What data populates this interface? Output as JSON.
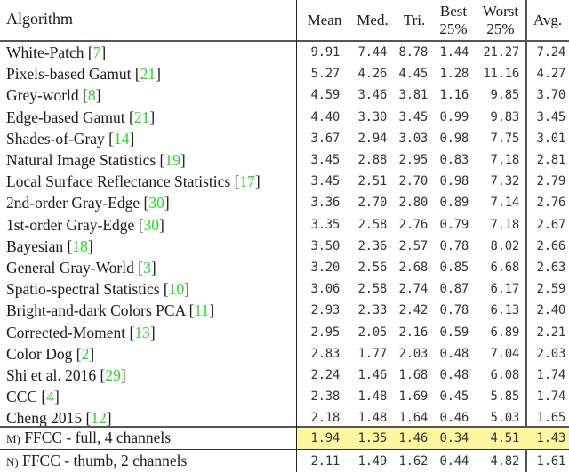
{
  "table": {
    "header": {
      "algorithm": "Algorithm",
      "columns": [
        {
          "l1": "Mean",
          "l2": ""
        },
        {
          "l1": "Med.",
          "l2": ""
        },
        {
          "l1": "Tri.",
          "l2": ""
        },
        {
          "l1": "Best",
          "l2": "25%"
        },
        {
          "l1": "Worst",
          "l2": "25%"
        },
        {
          "l1": "Avg.",
          "l2": ""
        }
      ]
    },
    "rows": [
      {
        "name": "White-Patch ",
        "ref": "7",
        "values": [
          "9.91",
          "7.44",
          "8.78",
          "1.44",
          "21.27",
          "7.24"
        ]
      },
      {
        "name": "Pixels-based Gamut ",
        "ref": "21",
        "values": [
          "5.27",
          "4.26",
          "4.45",
          "1.28",
          "11.16",
          "4.27"
        ]
      },
      {
        "name": "Grey-world ",
        "ref": "8",
        "values": [
          "4.59",
          "3.46",
          "3.81",
          "1.16",
          "9.85",
          "3.70"
        ]
      },
      {
        "name": "Edge-based Gamut ",
        "ref": "21",
        "values": [
          "4.40",
          "3.30",
          "3.45",
          "0.99",
          "9.83",
          "3.45"
        ]
      },
      {
        "name": "Shades-of-Gray ",
        "ref": "14",
        "values": [
          "3.67",
          "2.94",
          "3.03",
          "0.98",
          "7.75",
          "3.01"
        ]
      },
      {
        "name": "Natural Image Statistics ",
        "ref": "19",
        "values": [
          "3.45",
          "2.88",
          "2.95",
          "0.83",
          "7.18",
          "2.81"
        ]
      },
      {
        "name": "Local Surface Reflectance Statistics ",
        "ref": "17",
        "values": [
          "3.45",
          "2.51",
          "2.70",
          "0.98",
          "7.32",
          "2.79"
        ]
      },
      {
        "name": "2nd-order Gray-Edge ",
        "ref": "30",
        "values": [
          "3.36",
          "2.70",
          "2.80",
          "0.89",
          "7.14",
          "2.76"
        ]
      },
      {
        "name": "1st-order Gray-Edge ",
        "ref": "30",
        "values": [
          "3.35",
          "2.58",
          "2.76",
          "0.79",
          "7.18",
          "2.67"
        ]
      },
      {
        "name": "Bayesian ",
        "ref": "18",
        "values": [
          "3.50",
          "2.36",
          "2.57",
          "0.78",
          "8.02",
          "2.66"
        ]
      },
      {
        "name": "General Gray-World ",
        "ref": "3",
        "values": [
          "3.20",
          "2.56",
          "2.68",
          "0.85",
          "6.68",
          "2.63"
        ]
      },
      {
        "name": "Spatio-spectral Statistics ",
        "ref": "10",
        "values": [
          "3.06",
          "2.58",
          "2.74",
          "0.87",
          "6.17",
          "2.59"
        ]
      },
      {
        "name": "Bright-and-dark Colors PCA ",
        "ref": "11",
        "values": [
          "2.93",
          "2.33",
          "2.42",
          "0.78",
          "6.13",
          "2.40"
        ]
      },
      {
        "name": "Corrected-Moment ",
        "ref": "13",
        "values": [
          "2.95",
          "2.05",
          "2.16",
          "0.59",
          "6.89",
          "2.21"
        ]
      },
      {
        "name": "Color Dog ",
        "ref": "2",
        "values": [
          "2.83",
          "1.77",
          "2.03",
          "0.48",
          "7.04",
          "2.03"
        ]
      },
      {
        "name": "Shi et al. 2016 ",
        "ref": "29",
        "values": [
          "2.24",
          "1.46",
          "1.68",
          "0.48",
          "6.08",
          "1.74"
        ]
      },
      {
        "name": "CCC ",
        "ref": "4",
        "values": [
          "2.38",
          "1.48",
          "1.69",
          "0.45",
          "5.85",
          "1.74"
        ]
      },
      {
        "name": "Cheng 2015 ",
        "ref": "12",
        "values": [
          "2.18",
          "1.48",
          "1.64",
          "0.46",
          "5.03",
          "1.65"
        ]
      }
    ],
    "ours": [
      {
        "prefix": "M)",
        "name": " FFCC - full, 4 channels",
        "values": [
          "1.94",
          "1.35",
          "1.46",
          "0.34",
          "4.51",
          "1.43"
        ],
        "highlight": true
      },
      {
        "prefix": "N)",
        "name": " FFCC - thumb, 2 channels",
        "values": [
          "2.11",
          "1.49",
          "1.62",
          "0.44",
          "4.82",
          "1.61"
        ],
        "highlight": false
      }
    ],
    "colors": {
      "citation": "#22dd22",
      "highlight": "#fdf8a0"
    }
  }
}
